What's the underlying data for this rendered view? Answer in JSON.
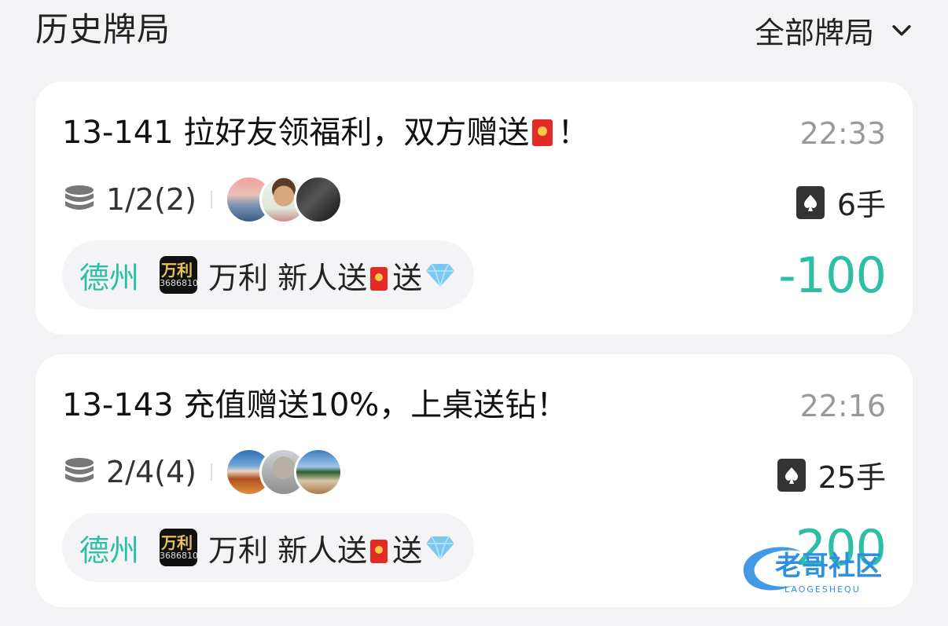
{
  "header": {
    "title": "历史牌局",
    "filter_label": "全部牌局"
  },
  "games": [
    {
      "room_prefix": "13-141 拉好友领福利，双方赠送",
      "room_suffix": "！",
      "time": "22:33",
      "blinds": "1/2(2)",
      "hands": "6手",
      "game_type": "德州",
      "club_logo_text": "万利",
      "club_logo_sub": "3686810",
      "club_name_a": "万利 新人送",
      "club_name_b": "送",
      "result": "-100",
      "result_color": "#2dbfa3"
    },
    {
      "room_prefix": "13-143 充值赠送10%，上桌送钻！",
      "room_suffix": "",
      "time": "22:16",
      "blinds": "2/4(4)",
      "hands": "25手",
      "game_type": "德州",
      "club_logo_text": "万利",
      "club_logo_sub": "3686810",
      "club_name_a": "万利 新人送",
      "club_name_b": "送",
      "result": "200",
      "result_color": "#2dbfa3"
    }
  ],
  "watermark": {
    "text": "老哥社区",
    "sub": "LAOGESHEQU"
  },
  "colors": {
    "accent": "#2dbfa3",
    "background": "#f3f3f5",
    "card": "#ffffff",
    "muted": "#9a9a9a"
  },
  "icons": [
    "chevron-down-icon",
    "coin-stack-icon",
    "playing-card-icon",
    "red-packet-icon",
    "diamond-icon"
  ]
}
